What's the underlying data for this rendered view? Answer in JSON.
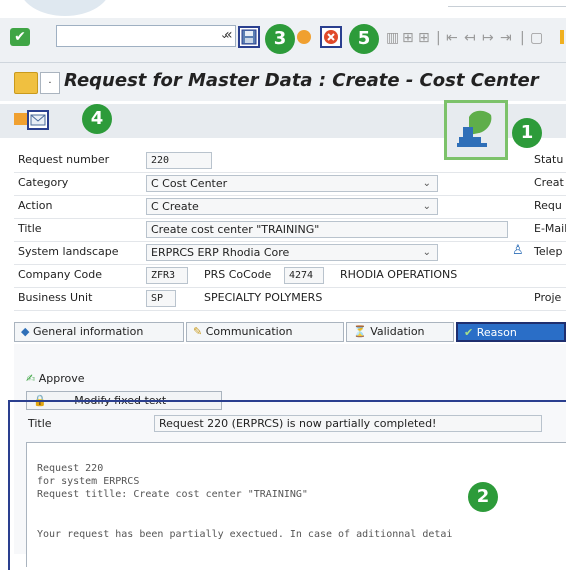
{
  "toolbar": {
    "command_value": "",
    "dropdown_glyph": "⌄",
    "double_arrow": "«",
    "markers": {
      "save": "3",
      "cancel": "5",
      "mail": "4",
      "icon1": "1",
      "text2": "2"
    }
  },
  "title": "Request for Master Data : Create - Cost Center",
  "form": {
    "request_number": {
      "label": "Request number",
      "value": "220"
    },
    "category": {
      "label": "Category",
      "value": "C Cost Center"
    },
    "action": {
      "label": "Action",
      "value": "C Create"
    },
    "title": {
      "label": "Title",
      "value": "Create cost center \"TRAINING\""
    },
    "system_landscape": {
      "label": "System landscape",
      "value": "ERPRCS ERP Rhodia Core"
    },
    "company_code": {
      "label": "Company Code",
      "value": "ZFR3",
      "prs_label": "PRS CoCode",
      "prs_value": "4274",
      "name": "RHODIA OPERATIONS"
    },
    "business_unit": {
      "label": "Business Unit",
      "value": "SP",
      "name": "SPECIALTY POLYMERS"
    },
    "right_labels": [
      "Statu",
      "Creat",
      "Requ",
      "E-Mail",
      "Telep",
      "Proje"
    ]
  },
  "tabs": [
    {
      "label": "General information"
    },
    {
      "label": "Communication"
    },
    {
      "label": "Validation"
    },
    {
      "label": "Reason"
    }
  ],
  "reason": {
    "approve_label": "Approve",
    "modify_label": "Modify fixed text",
    "title_label": "Title",
    "title_value": "Request 220 (ERPRCS) is now partially completed!",
    "body_lines": [
      "Request 220",
      "for system ERPRCS",
      "Request titlle: Create cost center \"TRAINING\"",
      "",
      "Your request has been partially exectued. In case of aditionnal detai"
    ]
  },
  "colors": {
    "accent_blue": "#2a3f8f",
    "badge_green": "#2d9b3a",
    "highlight_green": "#7cc26a"
  }
}
